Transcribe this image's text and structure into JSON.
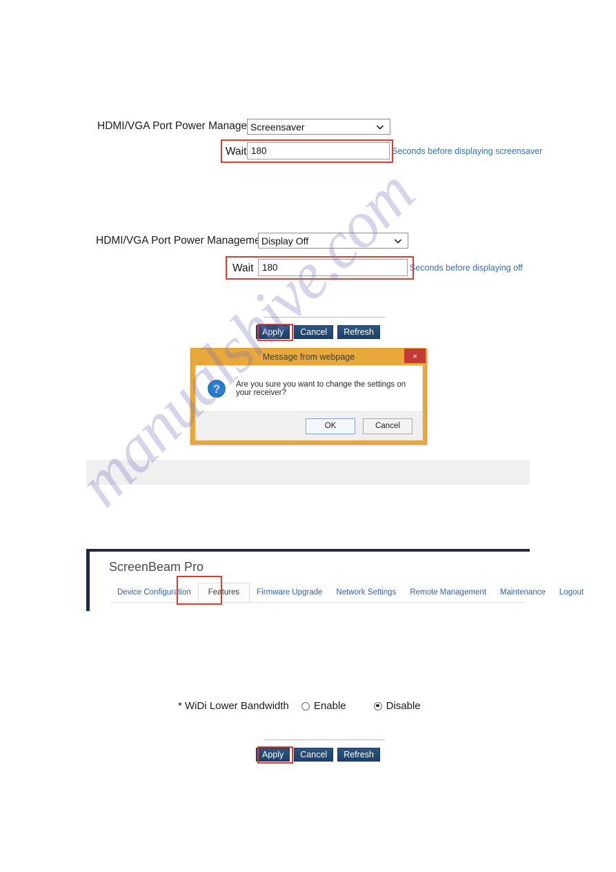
{
  "sections": [
    {
      "label": "HDMI/VGA Port Power Management",
      "select_value": "Screensaver",
      "wait_label": "Wait",
      "wait_value": "180",
      "hint": "Seconds before displaying screensaver"
    },
    {
      "label": "HDMI/VGA Port Power Management",
      "select_value": "Display Off",
      "wait_label": "Wait",
      "wait_value": "180",
      "hint": "Seconds before displaying off"
    }
  ],
  "action_bar": {
    "apply_label": "Apply",
    "cancel_label": "Cancel",
    "refresh_label": "Refresh"
  },
  "dialog": {
    "title": "Message from webpage",
    "close_label": "×",
    "message": "Are you sure you want to change the settings on your receiver?",
    "ok_label": "OK",
    "cancel_label": "Cancel",
    "icon": "question-icon"
  },
  "screenbeam": {
    "brand": "ScreenBeam Pro",
    "nav": [
      {
        "label": "Device Configuration",
        "active": false
      },
      {
        "label": "Features",
        "active": true
      },
      {
        "label": "Firmware Upgrade",
        "active": false
      },
      {
        "label": "Network Settings",
        "active": false
      },
      {
        "label": "Remote Management",
        "active": false
      },
      {
        "label": "Maintenance",
        "active": false
      },
      {
        "label": "Logout",
        "active": false
      }
    ]
  },
  "widi": {
    "label": "* WiDi Lower Bandwidth",
    "enable_label": "Enable",
    "disable_label": "Disable",
    "selected": "Disable"
  },
  "watermark": {
    "text": "manualshive.com"
  },
  "colors": {
    "highlight_red": "#e03a2f",
    "hint_blue": "#2f6fd0",
    "button_navy": "#234a74",
    "dialog_gold": "#e8a93a",
    "panel_navy": "#1c2b4a",
    "nav_link_blue": "#2f5fb0"
  }
}
